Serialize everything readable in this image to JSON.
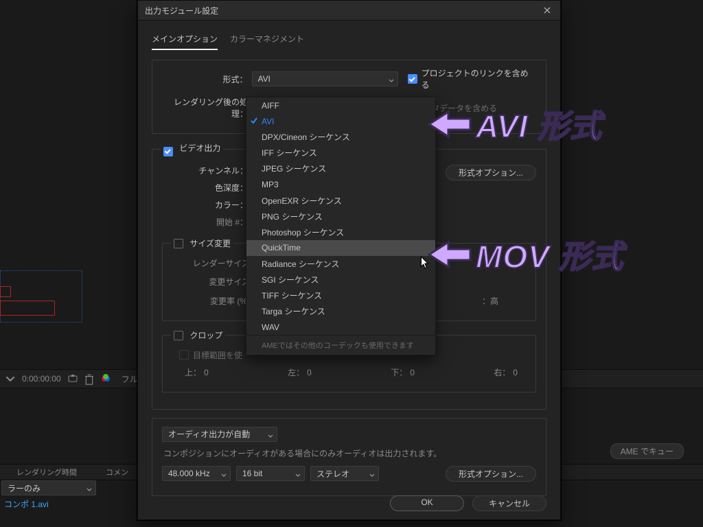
{
  "dialog": {
    "title": "出力モジュール設定",
    "tabs": {
      "main": "メインオプション",
      "color": "カラーマネジメント"
    },
    "format_label": "形式：",
    "format_value": "AVI",
    "post_render_label": "レンダリング後の処理：",
    "include_project_link": "プロジェクトのリンクを含める",
    "include_xmp": "XMP メタデータを含める",
    "video_output": "ビデオ出力",
    "channel_label": "チャンネル：",
    "depth_label": "色深度：",
    "color_label": "カラー：",
    "start_label": "開始 #：",
    "format_options_btn": "形式オプション...",
    "resize_group": "サイズ変更",
    "render_size_label": "レンダーサイズ：",
    "resize_to_label": "変更サイズ：",
    "resize_pct_label": "変更率 (%)：",
    "resize_quality_label": "：高",
    "crop_group": "クロップ",
    "crop_target": "目標範囲を使",
    "top": "上：",
    "left": "左：",
    "bottom": "下：",
    "right": "右：",
    "zero": "0",
    "audio_auto": "オーディオ出力が自動",
    "audio_note": "コンポジションにオーディオがある場合にのみオーディオは出力されます。",
    "audio_hz": "48.000 kHz",
    "audio_bits": "16 bit",
    "audio_ch": "ステレオ",
    "ok": "OK",
    "cancel": "キャンセル"
  },
  "dropdown": {
    "items": [
      "AIFF",
      "AVI",
      "DPX/Cineon シーケンス",
      "IFF シーケンス",
      "JPEG シーケンス",
      "MP3",
      "OpenEXR シーケンス",
      "PNG シーケンス",
      "Photoshop シーケンス",
      "QuickTime",
      "Radiance シーケンス",
      "SGI シーケンス",
      "TIFF シーケンス",
      "Targa シーケンス",
      "WAV"
    ],
    "selected": "AVI",
    "hover": "QuickTime",
    "footer": "AMEではその他のコーデックも使用できます"
  },
  "bg": {
    "timecode": "0:00:00:00",
    "cols": {
      "render_time": "レンダリング時間",
      "comment": "コメン"
    },
    "row": {
      "label": "ラーのみ",
      "file": "コンポ 1.avi"
    },
    "ame_btn": "AME でキュー"
  },
  "annotations": {
    "avi": "AVI 形式",
    "mov": "MOV 形式"
  }
}
